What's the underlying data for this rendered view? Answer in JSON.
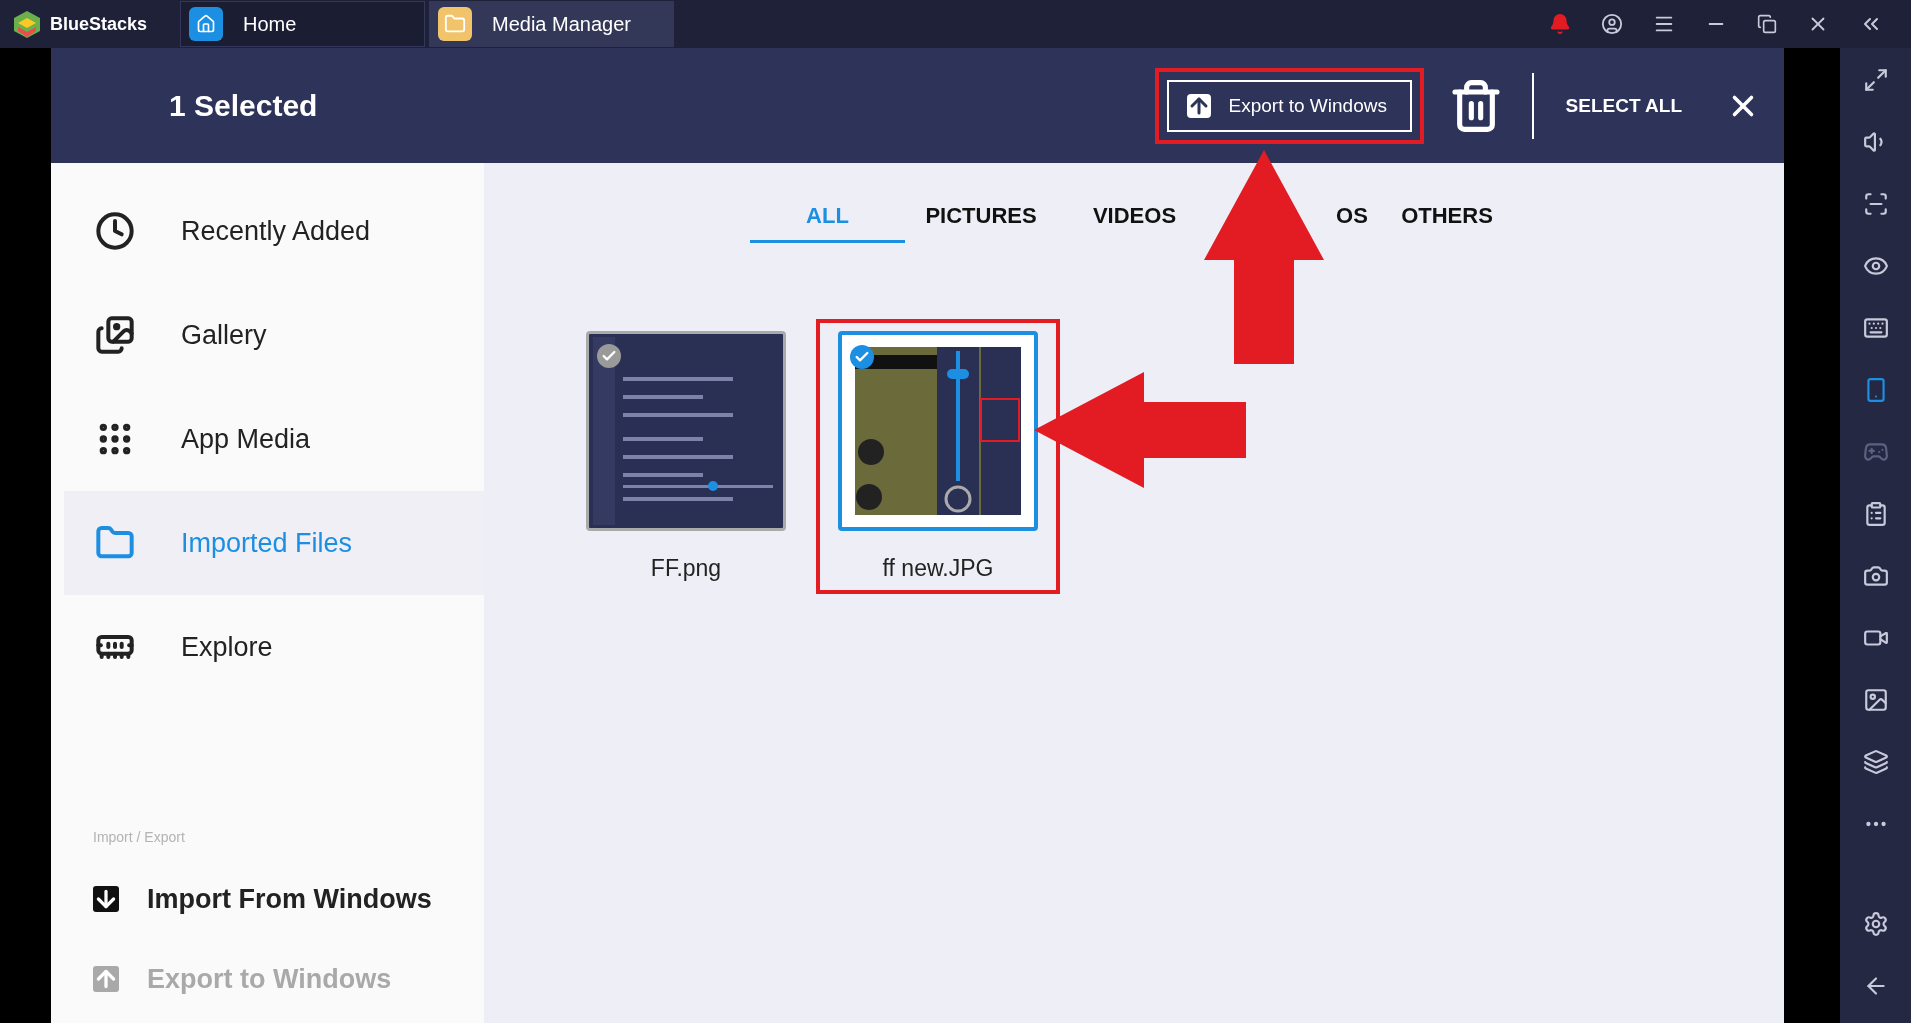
{
  "app": {
    "name": "BlueStacks"
  },
  "window_tabs": [
    {
      "label": "Home",
      "kind": "home",
      "selected": false
    },
    {
      "label": "Media Manager",
      "kind": "folder",
      "selected": true
    }
  ],
  "header": {
    "title": "1 Selected",
    "export_button": "Export to Windows",
    "select_all": "SELECT ALL"
  },
  "sidebar": {
    "items": [
      {
        "label": "Recently Added",
        "kind": "clock",
        "selected": false
      },
      {
        "label": "Gallery",
        "kind": "gallery",
        "selected": false
      },
      {
        "label": "App Media",
        "kind": "grid",
        "selected": false
      },
      {
        "label": "Imported Files",
        "kind": "folder",
        "selected": true
      },
      {
        "label": "Explore",
        "kind": "sdcard",
        "selected": false
      }
    ],
    "section_label": "Import / Export",
    "actions": [
      {
        "label": "Import From Windows",
        "kind": "import",
        "disabled": false
      },
      {
        "label": "Export to Windows",
        "kind": "export",
        "disabled": true
      }
    ]
  },
  "filter_tabs": [
    {
      "label": "ALL",
      "selected": true
    },
    {
      "label": "PICTURES",
      "selected": false
    },
    {
      "label": "VIDEOS",
      "selected": false
    },
    {
      "label": "OS",
      "selected": false
    },
    {
      "label": "OTHERS",
      "selected": false
    }
  ],
  "files": [
    {
      "name": "FF.png",
      "kind": "settings",
      "selected": false
    },
    {
      "name": "ff new.JPG",
      "kind": "game",
      "selected": true
    }
  ]
}
